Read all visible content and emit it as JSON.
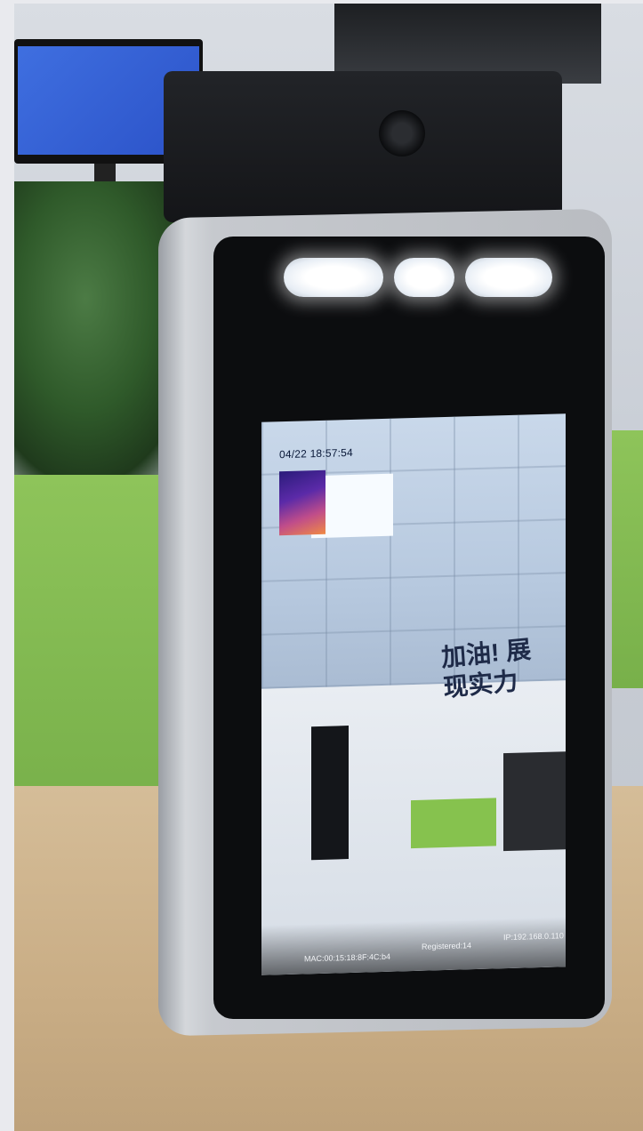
{
  "screen": {
    "timestamp": "04/22 18:57:54",
    "mac": "MAC:00:15:18:8F:4C:b4",
    "registered": "Registered:14",
    "ip": "IP:192.168.0.110",
    "wall_text": "加油! 展现实力"
  },
  "colors": {
    "accent_green": "#86c24e",
    "frame_silver": "#c6c9ce",
    "face_black": "#0c0d0f"
  }
}
